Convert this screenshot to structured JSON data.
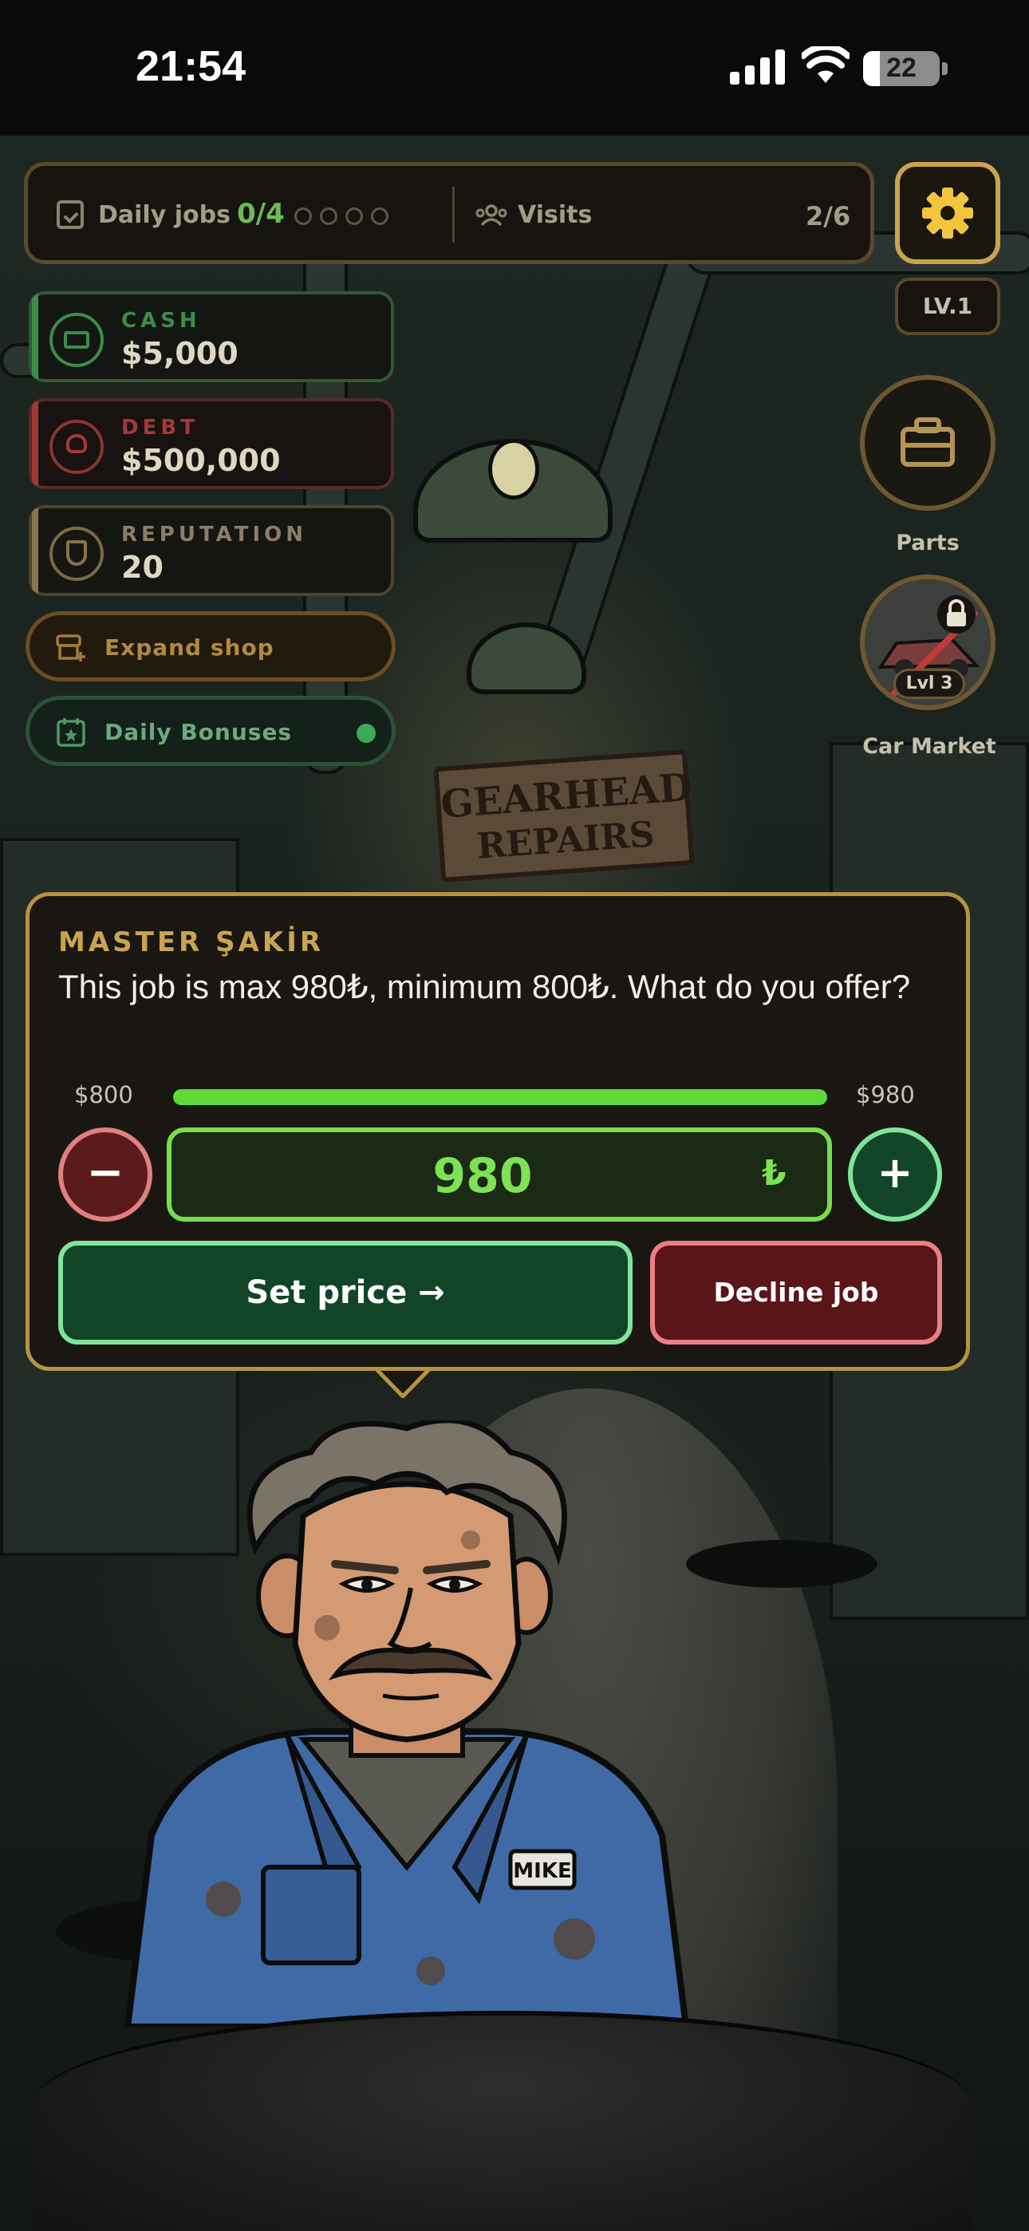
{
  "status_bar": {
    "time": "21:54",
    "battery": "22",
    "battery_level": 0.22
  },
  "top_bar": {
    "daily_jobs_label": "Daily jobs",
    "daily_jobs_count": "0/4",
    "visits_label": "Visits",
    "visits_count": "2/6",
    "level": "LV.1"
  },
  "stats": {
    "cash_label": "CASH",
    "cash_value": "$5,000",
    "debt_label": "DEBT",
    "debt_value": "$500,000",
    "reputation_label": "REPUTATION",
    "reputation_value": "20"
  },
  "actions": {
    "expand_shop": "Expand shop",
    "daily_bonuses": "Daily Bonuses"
  },
  "side": {
    "parts_label": "Parts",
    "car_market_label": "Car Market",
    "car_market_lock": "Lvl 3"
  },
  "scene": {
    "sign_line1": "GEARHEAD",
    "sign_line2": "REPAIRS",
    "nametag": "MIKE"
  },
  "dialog": {
    "speaker": "MASTER ŞAKİR",
    "message": "This job is max 980₺, minimum 800₺. What do you offer?",
    "min_label": "$800",
    "max_label": "$980",
    "slider_fraction": 1.0,
    "minus_label": "−",
    "plus_label": "+",
    "price_value": "980",
    "currency": "₺",
    "set_price": "Set price →",
    "decline": "Decline job"
  },
  "colors": {
    "accent_gold": "#c9a44c",
    "cash_green": "#6dbb56",
    "debt_red": "#b34a4a",
    "price_green": "#7fe154"
  },
  "icons": [
    "clipboard-check-icon",
    "users-icon",
    "gear-icon",
    "money-icon",
    "skull-icon",
    "shield-star-icon",
    "store-plus-icon",
    "calendar-star-icon",
    "toolbox-icon",
    "lock-icon"
  ]
}
